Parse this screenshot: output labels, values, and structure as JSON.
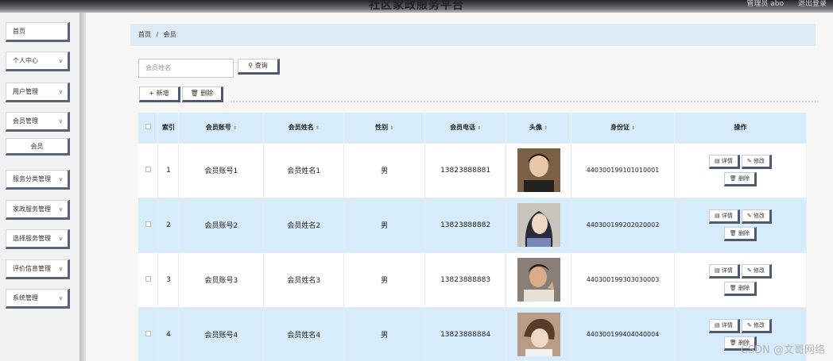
{
  "header": {
    "title": "社区家政服务平台",
    "user": "管理员 abo",
    "logout": "退出登录"
  },
  "sidebar": {
    "items": [
      {
        "label": "首页",
        "has_chevron": false
      },
      {
        "label": "个人中心",
        "has_chevron": true
      },
      {
        "label": "用户管理",
        "has_chevron": true
      },
      {
        "label": "会员管理",
        "has_chevron": true
      },
      {
        "label": "会员",
        "sub": true
      },
      {
        "label": "服务分类管理",
        "has_chevron": true
      },
      {
        "label": "家政服务管理",
        "has_chevron": true
      },
      {
        "label": "选择服务管理",
        "has_chevron": true
      },
      {
        "label": "评价信息管理",
        "has_chevron": true
      },
      {
        "label": "系统管理",
        "has_chevron": true
      }
    ]
  },
  "breadcrumb": {
    "home": "首页",
    "separator": "/",
    "current": "会员"
  },
  "search": {
    "placeholder": "会员姓名",
    "button": "查询",
    "icon": "search-icon"
  },
  "toolbar": {
    "add": "新增",
    "delete": "删除"
  },
  "table": {
    "columns": [
      "索引",
      "会员账号",
      "会员姓名",
      "性别",
      "会员电话",
      "头像",
      "身份证",
      "操作"
    ],
    "rows": [
      {
        "index": "1",
        "account": "会员账号1",
        "name": "会员姓名1",
        "gender": "男",
        "phone": "13823888881",
        "idcard": "440300199101010001"
      },
      {
        "index": "2",
        "account": "会员账号2",
        "name": "会员姓名2",
        "gender": "男",
        "phone": "13823888882",
        "idcard": "440300199202020002"
      },
      {
        "index": "3",
        "account": "会员账号3",
        "name": "会员姓名3",
        "gender": "男",
        "phone": "13823888883",
        "idcard": "440300199303030003"
      },
      {
        "index": "4",
        "account": "会员账号4",
        "name": "会员姓名4",
        "gender": "男",
        "phone": "13823888884",
        "idcard": "440300199404040004"
      }
    ],
    "ops": {
      "detail": "详情",
      "edit": "修改",
      "delete": "删除"
    }
  },
  "watermark": "CSDN @文哥网络",
  "colors": {
    "accent": "#4f5a70",
    "header_bg": "#d7ecfa",
    "breadcrumb_bg": "#dcebf6"
  }
}
